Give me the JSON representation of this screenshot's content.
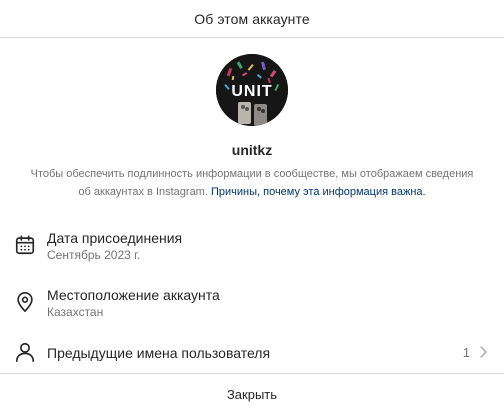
{
  "header": {
    "title": "Об этом аккаунте"
  },
  "profile": {
    "username": "unitkz",
    "avatar_text": "UNIT",
    "info_text": "Чтобы обеспечить подлинность информации в сообществе, мы отображаем сведения об аккаунтах в Instagram.",
    "info_link": "Причины, почему эта информация важна."
  },
  "rows": [
    {
      "title": "Дата присоединения",
      "subtitle": "Сентябрь 2023 г.",
      "icon": "calendar-icon"
    },
    {
      "title": "Местоположение аккаунта",
      "subtitle": "Казахстан",
      "icon": "location-pin-icon"
    },
    {
      "title": "Предыдущие имена пользователя",
      "count": "1",
      "icon": "person-icon"
    }
  ],
  "footer": {
    "close_label": "Закрыть"
  },
  "colors": {
    "link": "#00376b",
    "secondary_text": "#737373",
    "divider": "#dbdbdb"
  }
}
